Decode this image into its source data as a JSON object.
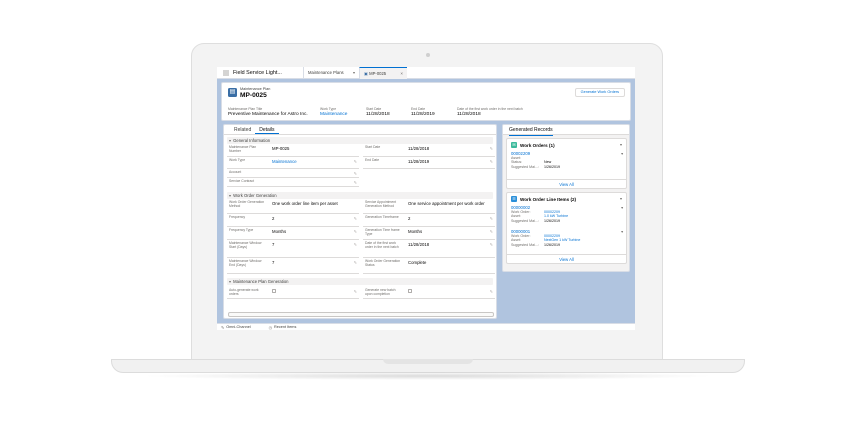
{
  "app": {
    "name": "Field Service Light..."
  },
  "tabs": [
    {
      "label": "Maintenance Plans"
    },
    {
      "label": "MP-0025"
    }
  ],
  "header": {
    "object_type": "Maintenance Plan",
    "record_name": "MP-0025",
    "action_button": "Generate Work Orders",
    "highlights": [
      {
        "label": "Maintenance Plan Title",
        "value": "Preventive Maintenance for Astro Inc."
      },
      {
        "label": "Work Type",
        "value": "Maintenance"
      },
      {
        "label": "Start Date",
        "value": "11/28/2018"
      },
      {
        "label": "End Date",
        "value": "11/28/2019"
      },
      {
        "label": "Date of the first work order in the next batch",
        "value": "11/28/2018"
      }
    ]
  },
  "detail_tabs": {
    "related": "Related",
    "details": "Details"
  },
  "sections": {
    "general": {
      "title": "General Information",
      "fields": [
        {
          "label": "Maintenance Plan Number",
          "value": "MP-0025"
        },
        {
          "label": "Start Date",
          "value": "11/28/2018"
        },
        {
          "label": "Work Type",
          "value": "Maintenance"
        },
        {
          "label": "End Date",
          "value": "11/28/2019"
        },
        {
          "label": "Account",
          "value": ""
        },
        {
          "label": "Service Contract",
          "value": ""
        }
      ]
    },
    "generation": {
      "title": "Work Order Generation",
      "fields": [
        {
          "label": "Work Order Generation Method",
          "value": "One work order line item per asset"
        },
        {
          "label": "Service Appointment Generation Method",
          "value": "One service appointment per work order"
        },
        {
          "label": "Frequency",
          "value": "2"
        },
        {
          "label": "Generation Timeframe",
          "value": "2"
        },
        {
          "label": "Frequency Type",
          "value": "Months"
        },
        {
          "label": "Generation Time frame Type",
          "value": "Months"
        },
        {
          "label": "Maintenance Window Start (Days)",
          "value": "7"
        },
        {
          "label": "Date of the first work order in the next batch",
          "value": "11/28/2018"
        },
        {
          "label": "Maintenance Window End (Days)",
          "value": "7"
        },
        {
          "label": "Work Order Generation Status",
          "value": "Complete"
        }
      ]
    },
    "plan_generation": {
      "title": "Maintenance Plan Generation",
      "fields": [
        {
          "label": "Auto-generate work orders",
          "value": ""
        },
        {
          "label": "Generate new batch upon completion",
          "value": ""
        }
      ]
    }
  },
  "generated_records": {
    "title": "Generated Records",
    "work_orders": {
      "title": "Work Orders (1)",
      "item": {
        "link": "00002209",
        "asset_label": "Asset:",
        "asset_value": "",
        "status_label": "Status:",
        "status_value": "New",
        "suggested_label": "Suggested Mai...:",
        "suggested_value": "1/26/2019"
      },
      "view_all": "View All"
    },
    "line_items": {
      "title": "Work Order Line Items (2)",
      "items": [
        {
          "link": "00000002",
          "wo_label": "Work Order:",
          "wo_value": "00002209",
          "asset_label": "Asset:",
          "asset_value": "1.0 kW Turbine",
          "suggested_label": "Suggested Mai...:",
          "suggested_value": "1/26/2019"
        },
        {
          "link": "00000001",
          "wo_label": "Work Order:",
          "wo_value": "00002209",
          "asset_label": "Asset:",
          "asset_value": "NextGen 1 kW Turbine",
          "suggested_label": "Suggested Mai...:",
          "suggested_value": "1/26/2019"
        }
      ],
      "view_all": "View All"
    }
  },
  "utility_bar": {
    "omni": "Omni-Channel",
    "recent": "Recent Items"
  },
  "colors": {
    "brand": "#0070d2",
    "plan_icon": "#3a6ea5",
    "wo_icon": "#3bba9c",
    "woli_icon": "#2a8fd9"
  }
}
